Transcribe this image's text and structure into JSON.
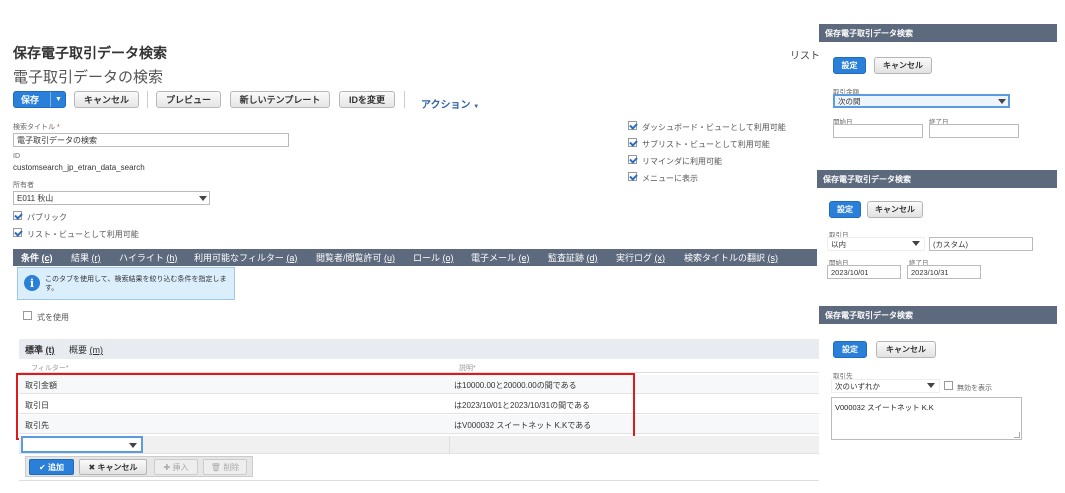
{
  "page": {
    "title": "保存電子取引データ検索",
    "subtitle": "電子取引データの検索",
    "list_link": "リスト",
    "toolbar": {
      "save": "保存",
      "cancel": "キャンセル",
      "preview": "プレビュー",
      "new_template": "新しいテンプレート",
      "change_id": "IDを変更",
      "actions": "アクション"
    }
  },
  "form": {
    "search_title_label": "検索タイトル",
    "required_mark": "*",
    "search_title_value": "電子取引データの検索",
    "id_label": "ID",
    "id_value": "customsearch_jp_etran_data_search",
    "owner_label": "所有者",
    "owner_value": "E011 秋山",
    "public_label": "パブリック",
    "list_view_label": "リスト・ビューとして利用可能",
    "dashboard_label": "ダッシュボード・ビューとして利用可能",
    "sublist_label": "サブリスト・ビューとして利用可能",
    "reminder_label": "リマインダに利用可能",
    "menu_label": "メニューに表示"
  },
  "tabs": [
    {
      "label": "条件",
      "key": "(c)"
    },
    {
      "label": "結果",
      "key": "(r)"
    },
    {
      "label": "ハイライト",
      "key": "(h)"
    },
    {
      "label": "利用可能なフィルター",
      "key": "(a)"
    },
    {
      "label": "閲覧者/閲覧許可",
      "key": "(u)"
    },
    {
      "label": "ロール",
      "key": "(o)"
    },
    {
      "label": "電子メール",
      "key": "(e)"
    },
    {
      "label": "監査証跡",
      "key": "(d)"
    },
    {
      "label": "実行ログ",
      "key": "(x)"
    },
    {
      "label": "検索タイトルの翻訳",
      "key": "(s)"
    }
  ],
  "info_text": "このタブを使用して、検索結果を絞り込む条件を指定します。",
  "use_formula_label": "式を使用",
  "subtabs": {
    "standard": "標準",
    "standard_key": "(t)",
    "summary": "概要",
    "summary_key": "(m)"
  },
  "grid": {
    "col_filter": "フィルター*",
    "col_desc": "説明*",
    "rows": [
      {
        "filter": "取引金額",
        "desc": "は10000.00と20000.00の間である"
      },
      {
        "filter": "取引日",
        "desc": "は2023/10/01と2023/10/31の間である"
      },
      {
        "filter": "取引先",
        "desc": "はV000032 スイートネット K.Kである"
      }
    ]
  },
  "row_actions": {
    "add": "追加",
    "cancel": "キャンセル",
    "insert": "挿入",
    "delete": "削除"
  },
  "panel1": {
    "title": "保存電子取引データ検索",
    "set": "設定",
    "cancel": "キャンセル",
    "field_label": "取引金額",
    "field_value": "次の間",
    "start_label": "開始日",
    "end_label": "終了日"
  },
  "panel2": {
    "title": "保存電子取引データ検索",
    "set": "設定",
    "cancel": "キャンセル",
    "field_label": "取引日",
    "field_value": "以内",
    "custom_value": "(カスタム)",
    "start_label": "開始日",
    "start_value": "2023/10/01",
    "end_label": "終了日",
    "end_value": "2023/10/31"
  },
  "panel3": {
    "title": "保存電子取引データ検索",
    "set": "設定",
    "cancel": "キャンセル",
    "field_label": "取引先",
    "field_value": "次のいずれか",
    "show_inactive": "無効を表示",
    "selected": "V000032 スイートネット K.K"
  },
  "colors": {
    "accent": "#2a7fd9",
    "tabbar": "#5d6a7e",
    "highlight_border": "#e0191b"
  }
}
